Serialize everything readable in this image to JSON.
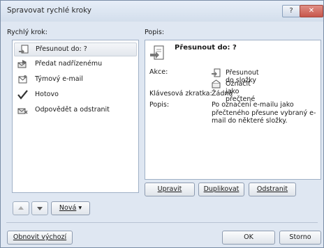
{
  "window": {
    "title": "Spravovat rychlé kroky"
  },
  "left": {
    "label": "Rychlý krok:",
    "items": [
      {
        "label": "Přesunout do: ?",
        "icon": "move-to-folder-icon",
        "selected": true
      },
      {
        "label": "Předat nadřízenému",
        "icon": "forward-icon",
        "selected": false
      },
      {
        "label": "Týmový e-mail",
        "icon": "team-email-icon",
        "selected": false
      },
      {
        "label": "Hotovo",
        "icon": "checkmark-icon",
        "selected": false
      },
      {
        "label": "Odpovědět a odstranit",
        "icon": "reply-delete-icon",
        "selected": false
      }
    ]
  },
  "right": {
    "label": "Popis:",
    "title": "Přesunout do: ?",
    "actions_label": "Akce:",
    "actions": [
      {
        "label": "Přesunout do složky",
        "icon": "move-to-folder-icon"
      },
      {
        "label": "Označit jako přečtené",
        "icon": "mark-read-icon"
      }
    ],
    "shortcut_label": "Klávesová zkratka:",
    "shortcut_value": "Žádná",
    "desc_label": "Popis:",
    "desc_value": "Po označení e-mailu jako přečteného přesune vybraný e-mail do některé složky."
  },
  "buttons": {
    "edit": "Upravit",
    "duplicate": "Duplikovat",
    "delete": "Odstranit",
    "new": "Nová",
    "reset": "Obnovit výchozí",
    "ok": "OK",
    "cancel": "Storno"
  }
}
